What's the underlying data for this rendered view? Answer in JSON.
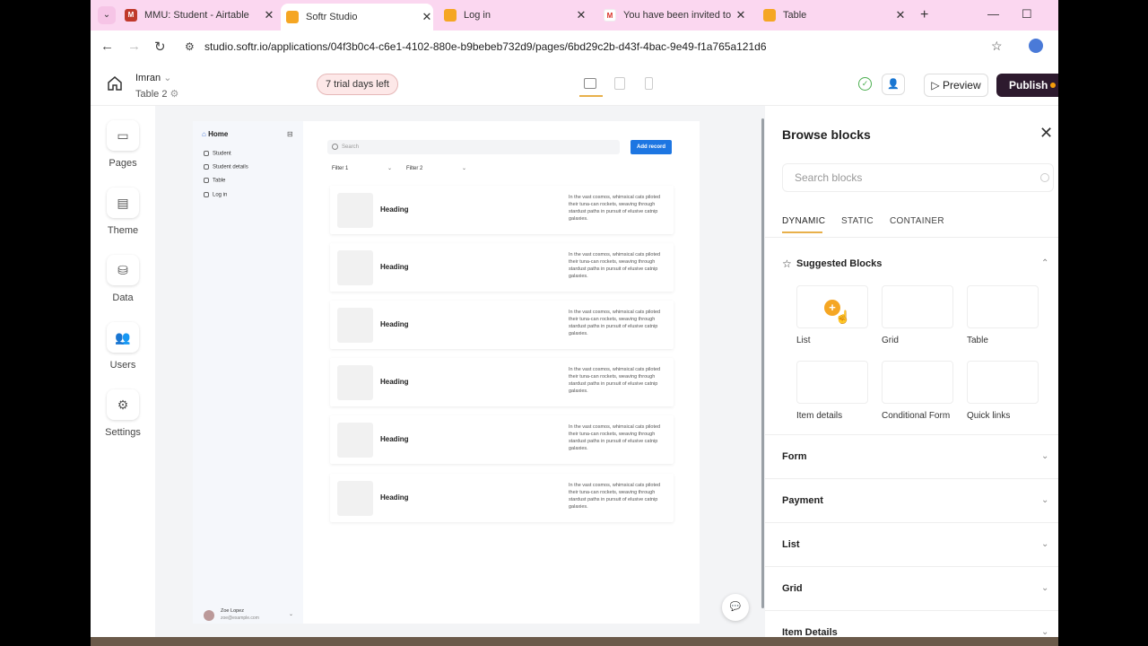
{
  "browser": {
    "tabs": [
      {
        "title": "MMU: Student - Airtable",
        "favicon": "airtable-icon",
        "active": false
      },
      {
        "title": "Softr Studio",
        "favicon": "softr-icon",
        "active": true
      },
      {
        "title": "Log in",
        "favicon": "softr-icon",
        "active": false
      },
      {
        "title": "You have been invited to Im",
        "favicon": "gmail-icon",
        "active": false
      },
      {
        "title": "Table",
        "favicon": "softr-icon",
        "active": false
      }
    ],
    "url": "studio.softr.io/applications/04f3b0c4-c6e1-4102-880e-b9bebeb732d9/pages/6bd29c2b-d43f-4bac-9e49-f1a765a121d6"
  },
  "header": {
    "workspace": "Imran",
    "page": "Table 2",
    "trial": "7 trial days left",
    "preview": "Preview",
    "publish": "Publish"
  },
  "rail": {
    "items": [
      {
        "label": "Pages",
        "icon": "pages-icon"
      },
      {
        "label": "Theme",
        "icon": "theme-icon"
      },
      {
        "label": "Data",
        "icon": "database-icon"
      },
      {
        "label": "Users",
        "icon": "users-icon"
      },
      {
        "label": "Settings",
        "icon": "gear-icon"
      }
    ]
  },
  "site": {
    "home": "Home",
    "nav": [
      "Student",
      "Student details",
      "Table",
      "Log in"
    ],
    "user_name": "Zoe Lopez",
    "user_email": "zoe@example.com",
    "search_placeholder": "Search",
    "add_record": "Add record",
    "filters": [
      "Filter 1",
      "Filter 2"
    ],
    "cards": [
      {
        "heading": "Heading",
        "text": "In the vast cosmos, whimsical cats piloted their tuna-can rockets, weaving through stardust paths in pursuit of elusive catnip galaxies."
      },
      {
        "heading": "Heading",
        "text": "In the vast cosmos, whimsical cats piloted their tuna-can rockets, weaving through stardust paths in pursuit of elusive catnip galaxies."
      },
      {
        "heading": "Heading",
        "text": "In the vast cosmos, whimsical cats piloted their tuna-can rockets, weaving through stardust paths in pursuit of elusive catnip galaxies."
      },
      {
        "heading": "Heading",
        "text": "In the vast cosmos, whimsical cats piloted their tuna-can rockets, weaving through stardust paths in pursuit of elusive catnip galaxies."
      },
      {
        "heading": "Heading",
        "text": "In the vast cosmos, whimsical cats piloted their tuna-can rockets, weaving through stardust paths in pursuit of elusive catnip galaxies."
      },
      {
        "heading": "Heading",
        "text": "In the vast cosmos, whimsical cats piloted their tuna-can rockets, weaving through stardust paths in pursuit of elusive catnip galaxies."
      }
    ]
  },
  "panel": {
    "title": "Browse blocks",
    "search_placeholder": "Search blocks",
    "tabs": [
      "DYNAMIC",
      "STATIC",
      "CONTAINER"
    ],
    "suggested_title": "Suggested Blocks",
    "blocks": [
      "List",
      "Grid",
      "Table",
      "Item details",
      "Conditional Form",
      "Quick links"
    ],
    "sections": [
      "Form",
      "Payment",
      "List",
      "Grid",
      "Item Details"
    ]
  },
  "colors": {
    "tabstrip": "#fbd7f0",
    "publish_bg": "#2d1a2e",
    "accent": "#e8b04a",
    "primary": "#1d76e2"
  }
}
